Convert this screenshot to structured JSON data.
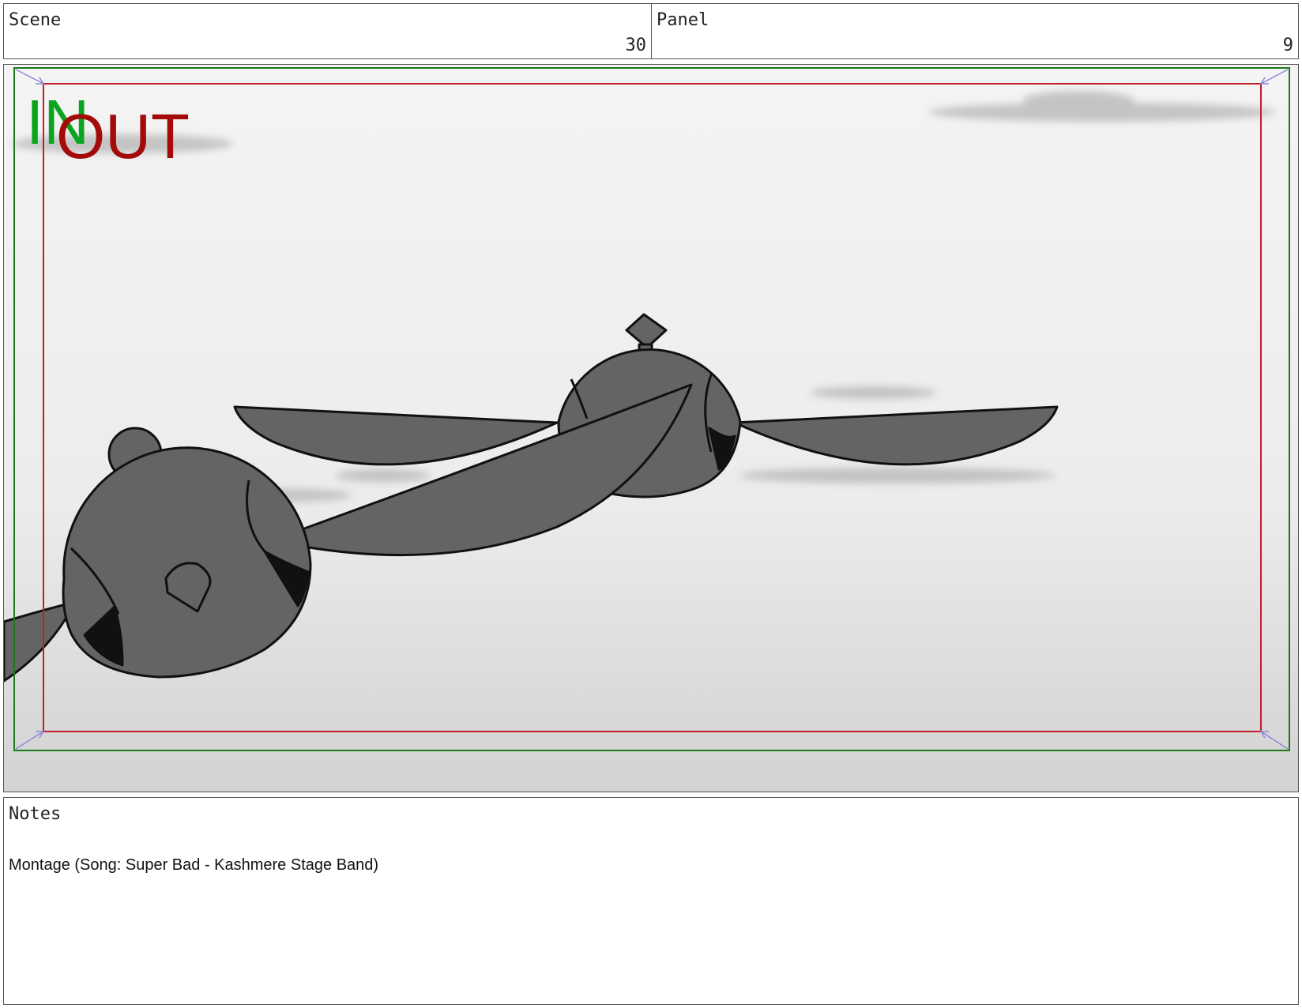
{
  "scene": {
    "label": "Scene",
    "value": "30"
  },
  "panel": {
    "label": "Panel",
    "value": "9"
  },
  "frame": {
    "in_marker": "IN",
    "out_marker": "OUT",
    "colors": {
      "in": "#0aa51e",
      "out": "#a50a0a",
      "safe_green": "#1a7a1a",
      "safe_red": "#c0202a",
      "ink": "#111111",
      "fill": "#646464"
    }
  },
  "notes": {
    "label": "Notes",
    "text": "Montage (Song: Super Bad - Kashmere Stage Band)"
  }
}
